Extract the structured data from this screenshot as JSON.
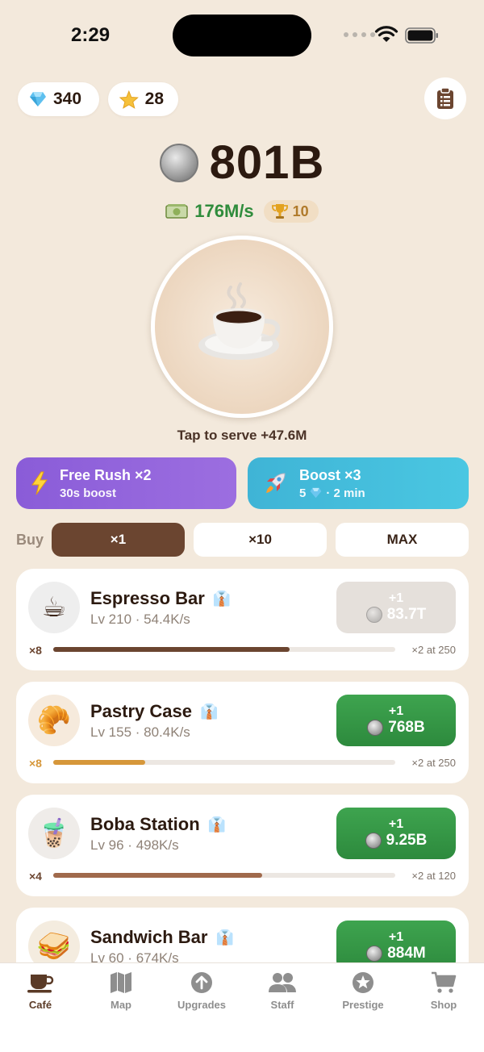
{
  "status": {
    "time": "2:29"
  },
  "currencies": {
    "gems": "340",
    "stars": "28"
  },
  "money": {
    "value": "801B"
  },
  "rate": {
    "per_second": "176M/s",
    "trophies": "10"
  },
  "tap": {
    "label": "Tap to serve  +47.6M"
  },
  "boosts": [
    {
      "title": "Free Rush ×2",
      "sub": "30s boost"
    },
    {
      "title": "Boost ×3",
      "sub_cost": "5",
      "sub_time": "· 2 min"
    }
  ],
  "buy": {
    "label": "Buy",
    "options": [
      "×1",
      "×10",
      "MAX"
    ],
    "selected": "×1"
  },
  "stations": [
    {
      "name": "Espresso Bar",
      "meta": "Lv 210 · 54.4K/s",
      "mult": "×8",
      "milestone": "×2 at 250",
      "plus": "+1",
      "cost": "83.7T",
      "progress": 0.69,
      "bar_color": "#6b4530",
      "mult_color": "#6b4530",
      "affordable": false,
      "icon": "coffee-cup-icon"
    },
    {
      "name": "Pastry Case",
      "meta": "Lv 155 · 80.4K/s",
      "mult": "×8",
      "milestone": "×2 at 250",
      "plus": "+1",
      "cost": "768B",
      "progress": 0.27,
      "bar_color": "#d6973a",
      "mult_color": "#d6973a",
      "affordable": true,
      "icon": "croissant-icon"
    },
    {
      "name": "Boba Station",
      "meta": "Lv 96 · 498K/s",
      "mult": "×4",
      "milestone": "×2 at 120",
      "plus": "+1",
      "cost": "9.25B",
      "progress": 0.61,
      "bar_color": "#a06a4c",
      "mult_color": "#6b4530",
      "affordable": true,
      "icon": "boba-icon"
    },
    {
      "name": "Sandwich Bar",
      "meta": "Lv 60 · 674K/s",
      "plus": "+1",
      "cost": "884M",
      "affordable": true,
      "icon": "sandwich-icon"
    }
  ],
  "tabs": [
    {
      "label": "Café",
      "icon": "cafe-icon",
      "active": true
    },
    {
      "label": "Map",
      "icon": "map-icon"
    },
    {
      "label": "Upgrades",
      "icon": "upgrade-arrow-icon"
    },
    {
      "label": "Staff",
      "icon": "people-icon"
    },
    {
      "label": "Prestige",
      "icon": "star-badge-icon"
    },
    {
      "label": "Shop",
      "icon": "cart-icon"
    }
  ]
}
